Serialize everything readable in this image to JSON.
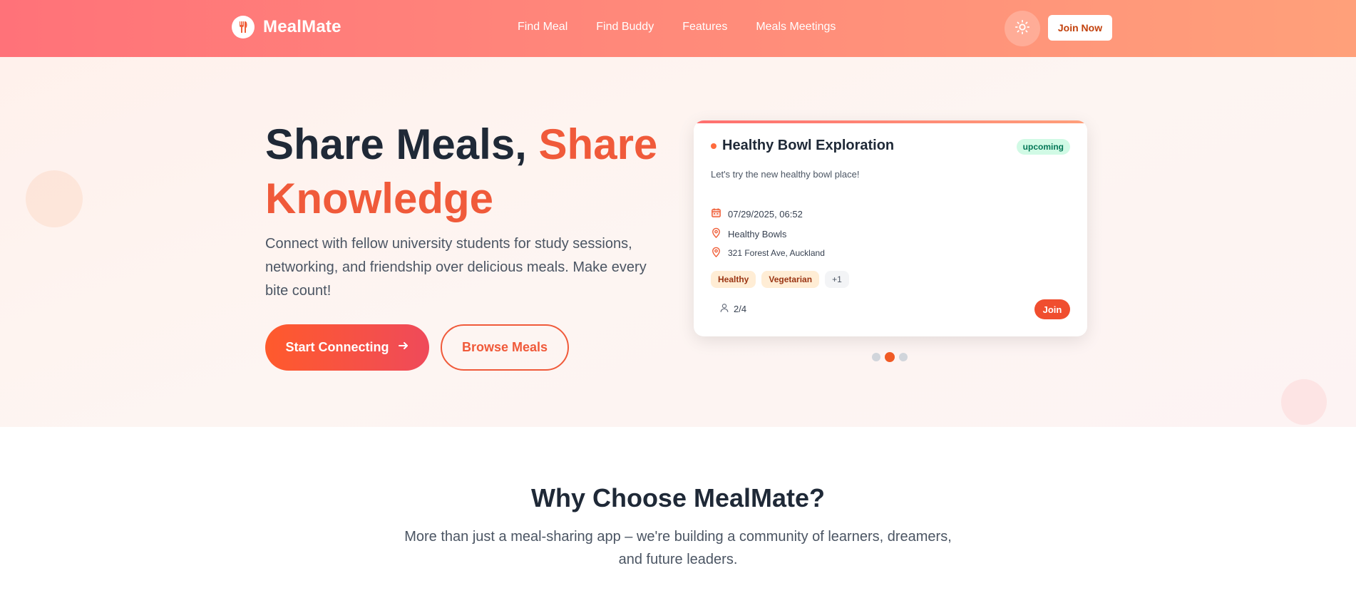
{
  "header": {
    "brand": "MealMate",
    "nav": [
      "Find Meal",
      "Find Buddy",
      "Features",
      "Meals Meetings"
    ],
    "join_label": "Join Now",
    "theme_icon": "sun-icon"
  },
  "hero": {
    "title_part1": "Share Meals,",
    "title_part2": "Share Knowledge",
    "description": "Connect with fellow university students for study sessions, networking, and friendship over delicious meals. Make every bite count!",
    "primary_button": "Start Connecting",
    "secondary_button": "Browse Meals"
  },
  "meal_card": {
    "title": "Healthy Bowl Exploration",
    "status": "upcoming",
    "description": "Let's try the new healthy bowl place!",
    "datetime": "07/29/2025, 06:52",
    "venue": "Healthy Bowls",
    "address": "321 Forest Ave, Auckland",
    "tags": [
      "Healthy",
      "Vegetarian"
    ],
    "more_tags": "+1",
    "attendees": "2/4",
    "join_label": "Join"
  },
  "carousel": {
    "count": 3,
    "active_index": 1
  },
  "why": {
    "title": "Why Choose MealMate?",
    "description": "More than just a meal-sharing app – we're building a community of learners, dreamers, and future leaders."
  },
  "colors": {
    "header_gradient_start": "#ff7279",
    "header_gradient_end": "#ffa07a",
    "accent": "#f05a3a",
    "status_green": "#047857"
  }
}
